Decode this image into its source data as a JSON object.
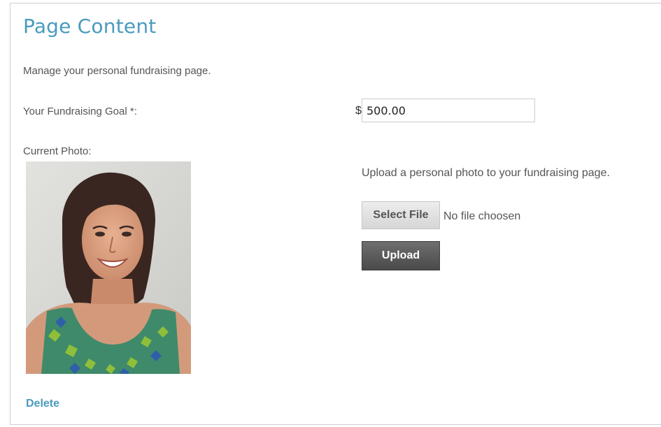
{
  "page": {
    "title": "Page Content",
    "intro": "Manage your personal fundraising page."
  },
  "goal": {
    "label": "Your Fundraising Goal *:",
    "currency_symbol": "$",
    "value": "500.00"
  },
  "photo": {
    "label": "Current Photo:",
    "image_icon": "portrait-photo"
  },
  "upload": {
    "instructions": "Upload a personal photo to your fundraising page.",
    "select_file_label": "Select File",
    "no_file_text": "No file choosen",
    "upload_label": "Upload"
  },
  "actions": {
    "delete_label": "Delete"
  },
  "colors": {
    "accent": "#4a9bbd",
    "text": "#555555",
    "upload_button": "#555555"
  }
}
